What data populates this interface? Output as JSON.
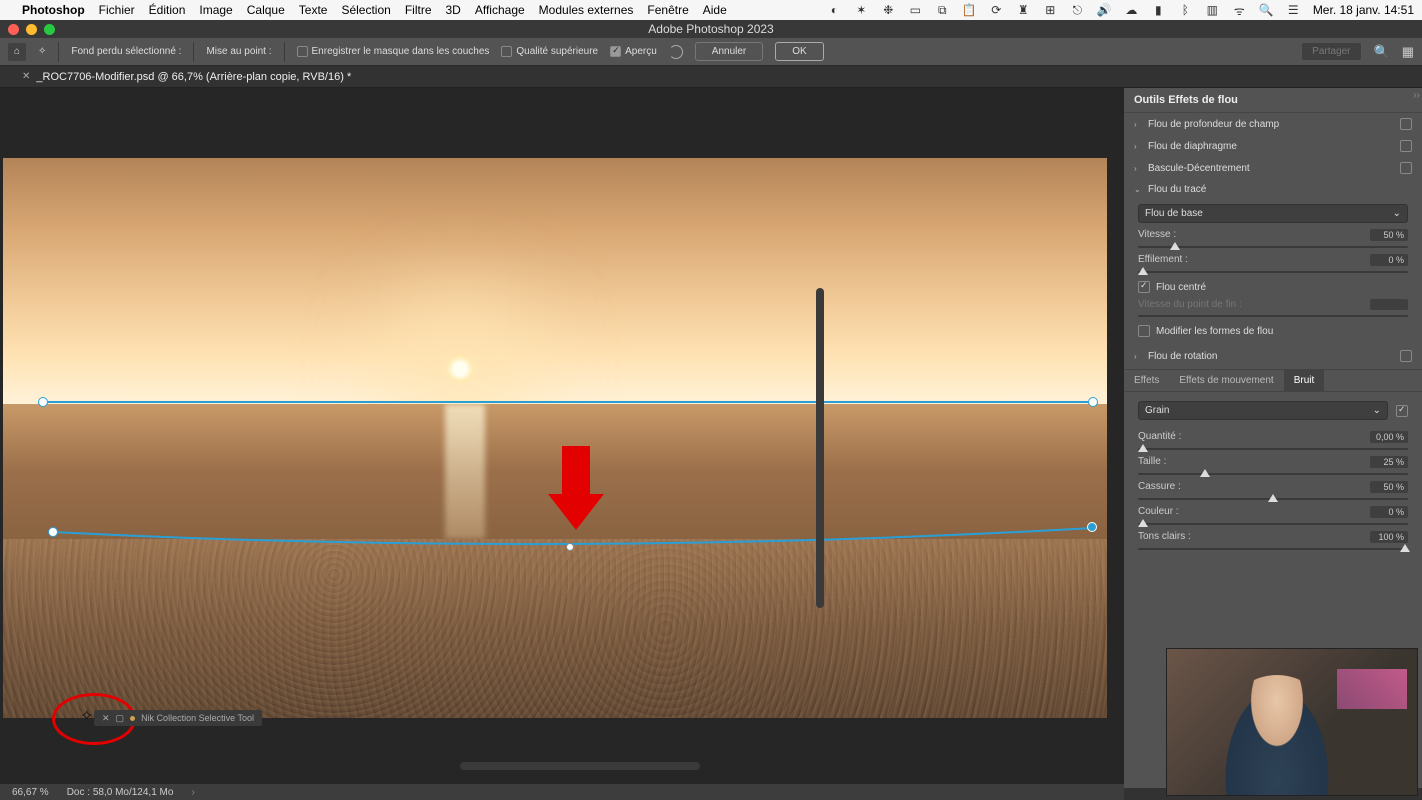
{
  "system": {
    "app_name": "Photoshop",
    "menus": [
      "Fichier",
      "Édition",
      "Image",
      "Calque",
      "Texte",
      "Sélection",
      "Filtre",
      "3D",
      "Affichage",
      "Modules externes",
      "Fenêtre",
      "Aide"
    ],
    "clock": "Mer. 18 janv.  14:51"
  },
  "window": {
    "title": "Adobe Photoshop 2023"
  },
  "options_bar": {
    "lost_bg": "Fond perdu sélectionné :",
    "focus": "Mise au point :",
    "save_mask": "Enregistrer le masque dans les couches",
    "hq": "Qualité supérieure",
    "preview": "Aperçu",
    "cancel": "Annuler",
    "ok": "OK",
    "share": "Partager"
  },
  "document": {
    "tab": "_ROC7706-Modifier.psd @ 66,7% (Arrière-plan copie, RVB/16) *"
  },
  "nik": {
    "label": "Nik Collection Selective Tool"
  },
  "panel": {
    "title": "Outils Effets de flou",
    "rows": {
      "depth": "Flou de profondeur de champ",
      "iris": "Flou de diaphragme",
      "tilt": "Bascule-Décentrement",
      "path": "Flou du tracé",
      "spin": "Flou de rotation"
    },
    "path": {
      "preset": "Flou de base",
      "speed_lbl": "Vitesse :",
      "speed_val": "50 %",
      "taper_lbl": "Effilement :",
      "taper_val": "0 %",
      "centered": "Flou centré",
      "endspeed_lbl": "Vitesse du point de fin :",
      "endspeed_val": "",
      "edit_shapes": "Modifier les formes de flou"
    },
    "tabs": {
      "effects": "Effets",
      "motion": "Effets de mouvement",
      "noise": "Bruit"
    },
    "noise": {
      "type": "Grain",
      "amount_lbl": "Quantité :",
      "amount_val": "0,00 %",
      "size_lbl": "Taille :",
      "size_val": "25 %",
      "rough_lbl": "Cassure :",
      "rough_val": "50 %",
      "color_lbl": "Couleur :",
      "color_val": "0 %",
      "high_lbl": "Tons clairs :",
      "high_val": "100 %"
    }
  },
  "status": {
    "zoom": "66,67 %",
    "doc": "Doc : 58,0 Mo/124,1 Mo"
  }
}
